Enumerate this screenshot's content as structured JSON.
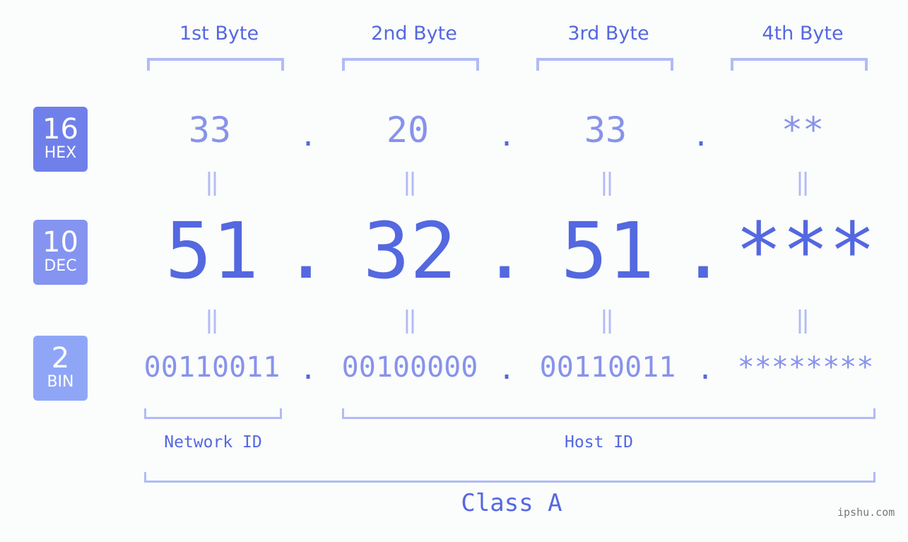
{
  "headers": [
    "1st Byte",
    "2nd Byte",
    "3rd Byte",
    "4th Byte"
  ],
  "badges": {
    "hex": {
      "num": "16",
      "label": "HEX",
      "color": "#7080ea"
    },
    "dec": {
      "num": "10",
      "label": "DEC",
      "color": "#8494f0"
    },
    "bin": {
      "num": "2",
      "label": "BIN",
      "color": "#8fa6f7"
    }
  },
  "hex": [
    "33",
    "20",
    "33",
    "**"
  ],
  "dec": [
    "51",
    "32",
    "51",
    "***"
  ],
  "bin": [
    "00110011",
    "00100000",
    "00110011",
    "********"
  ],
  "separator": ".",
  "equals": "=",
  "network_label": "Network ID",
  "host_label": "Host ID",
  "class_label": "Class A",
  "watermark": "ipshu.com",
  "colors": {
    "primary": "#5468e0",
    "secondary": "#8793ea",
    "bracket": "#b1bbf5"
  }
}
